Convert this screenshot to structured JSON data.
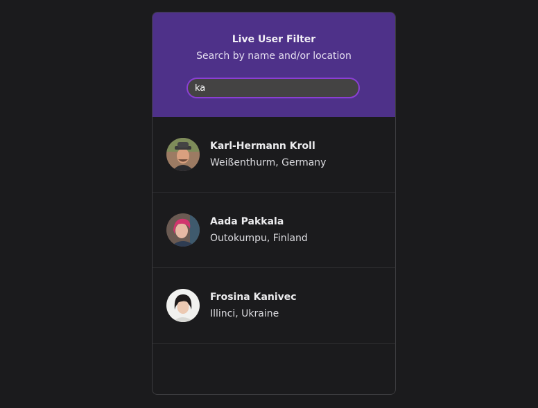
{
  "header": {
    "title": "Live User Filter",
    "subtitle": "Search by name and/or location"
  },
  "search": {
    "value": "ka",
    "placeholder": ""
  },
  "users": [
    {
      "name": "Karl-Hermann Kroll",
      "location": "Weißenthurm, Germany"
    },
    {
      "name": "Aada Pakkala",
      "location": "Outokumpu, Finland"
    },
    {
      "name": "Frosina Kanivec",
      "location": "Illinci, Ukraine"
    }
  ],
  "colors": {
    "page_background": "#1b1b1d",
    "header_background": "#4e3189",
    "search_border": "#8b3fd4",
    "search_background": "#444343"
  }
}
